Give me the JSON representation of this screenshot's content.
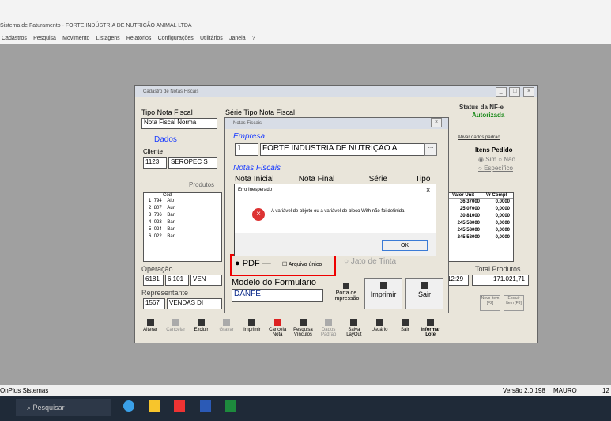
{
  "app": {
    "title": "Sistema de Faturamento - FORTE INDÚSTRIA DE NUTRIÇÃO ANIMAL LTDA"
  },
  "menu": [
    "Cadastros",
    "Pesquisa",
    "Movimento",
    "Listagens",
    "Relatorios",
    "Configurações",
    "Utilitários",
    "Janela",
    "?"
  ],
  "cadastro": {
    "title": "Cadastro de Notas Fiscais",
    "tipo_label": "Tipo Nota Fiscal",
    "tipo_value": "Nota Fiscal Norma",
    "serie_label": "Série Tipo Nota Fiscal",
    "status_label": "Status da NF-e",
    "status_value": "Autorizada",
    "dados_tab": "Dados",
    "cliente_label": "Cliente",
    "cliente_code": "1123",
    "cliente_name": "SEROPEC S",
    "produtos_label": "Produtos",
    "cols": [
      "Cod",
      "Valor Unit",
      "Vr Compl"
    ],
    "rows": [
      {
        "n": "1",
        "cod": "794",
        "desc": "Alp",
        "vu": "36,37000",
        "vc": "0,0000"
      },
      {
        "n": "2",
        "cod": "807",
        "desc": "Aur",
        "vu": "25,07000",
        "vc": "0,0000"
      },
      {
        "n": "3",
        "cod": "786",
        "desc": "Bar",
        "vu": "30,81000",
        "vc": "0,0000"
      },
      {
        "n": "4",
        "cod": "023",
        "desc": "Bar",
        "vu": "245,58000",
        "vc": "0,0000"
      },
      {
        "n": "5",
        "cod": "024",
        "desc": "Bar",
        "vu": "245,58000",
        "vc": "0,0000"
      },
      {
        "n": "6",
        "cod": "022",
        "desc": "Bar",
        "vu": "245,58000",
        "vc": "0,0000"
      }
    ],
    "ativar_label": "Ativar dados padrão",
    "itens_label": "Itens Pedido",
    "sim": "Sim",
    "nao": "Não",
    "especifico": "Específico",
    "operacao_label": "Operação",
    "op_code": "6181",
    "op_val": "6.101",
    "op_name": "VEN",
    "representante_label": "Representante",
    "rep_code": "1567",
    "rep_name": "VENDAS DI",
    "hora": "12:29",
    "total_label": "Total Produtos",
    "total_value": "171.021,71",
    "novo": "Novo Item [F2]",
    "excluir": "Excluir Item [F3]",
    "toolbar": [
      "Alterar",
      "Cancelar",
      "Excluir",
      "Gravar",
      "Imprimir",
      "Cancela Nota",
      "Pesquisa Vínculos",
      "Dados Padrão",
      "Salva LayOut",
      "Usuário",
      "Sair",
      "Informar Lote"
    ]
  },
  "notas": {
    "title": "Notas Fiscais",
    "empresa_label": "Empresa",
    "empresa_code": "1",
    "empresa_name": "FORTE INDÚSTRIA DE NUTRIÇÃO A",
    "notas_label": "Notas Fiscais",
    "cols": [
      "Nota Inicial",
      "Nota Final",
      "Série",
      "Tipo"
    ],
    "pdf": "PDF",
    "arquivo": "Arquivo único",
    "jato": "Jato de Tinta",
    "modelo_label": "Modelo do Formulário",
    "modelo_value": "DANFE",
    "porta": "Porta de Impressão",
    "imprimir": "Imprimir",
    "sair": "Sair"
  },
  "erro": {
    "title": "Erro Inesperado",
    "message": "A variável de objeto ou a variável de bloco With não foi definida",
    "ok": "OK"
  },
  "status": {
    "left": "OnPlus Sistemas",
    "version": "Versão 2.0.198",
    "user": "MAURO",
    "extra": "12"
  },
  "taskbar": {
    "search": "Pesquisar"
  }
}
